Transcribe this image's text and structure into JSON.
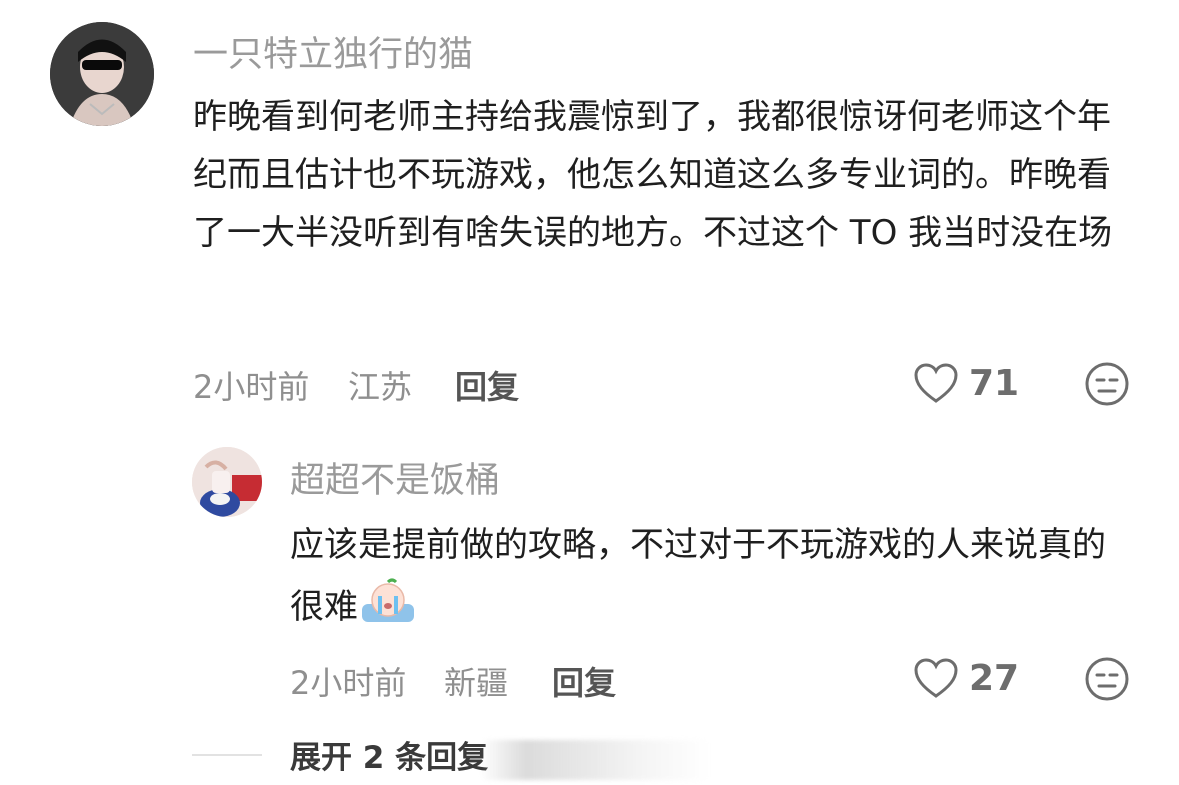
{
  "comments": [
    {
      "username": "一只特立独行的猫",
      "text": "昨晚看到何老师主持给我震惊到了，我都很惊讶何老师这个年纪而且估计也不玩游戏，他怎么知道这么多专业词的。昨晚看了一大半没听到有啥失误的地方。不过这个 TO 我当时没在场",
      "time": "2小时前",
      "location": "江苏",
      "reply_label": "回复",
      "likes": "71"
    },
    {
      "username": "超超不是饭桶",
      "text": "应该是提前做的攻略，不过对于不玩游戏的人来说真的很难",
      "emoji": "crying-face-emoji",
      "time": "2小时前",
      "location": "新疆",
      "reply_label": "回复",
      "likes": "27"
    }
  ],
  "expand": {
    "label": "展开 2 条回复"
  },
  "colors": {
    "username": "#9a9a9a",
    "text": "#1f1f1f",
    "meta": "#8f8f8f",
    "icon": "#6d6d6d"
  }
}
